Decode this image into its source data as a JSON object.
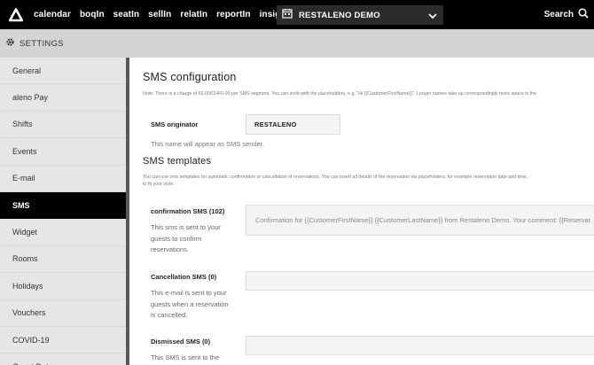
{
  "nav": {
    "items": [
      {
        "label": "calendar"
      },
      {
        "label": "boqIn"
      },
      {
        "label": "seatIn"
      },
      {
        "label": "sellIn"
      },
      {
        "label": "relatIn"
      },
      {
        "label": "reportIn"
      },
      {
        "label": "insights"
      }
    ],
    "venue": "RESTALENO DEMO",
    "search_label": "Search"
  },
  "settings": {
    "title": "SETTINGS"
  },
  "sidebar": {
    "items": [
      {
        "label": "General"
      },
      {
        "label": "aleno Pay"
      },
      {
        "label": "Shifts"
      },
      {
        "label": "Events"
      },
      {
        "label": "E-mail"
      },
      {
        "label": "SMS"
      },
      {
        "label": "Widget"
      },
      {
        "label": "Rooms"
      },
      {
        "label": "Holidays"
      },
      {
        "label": "Vouchers"
      },
      {
        "label": "COVID-19"
      },
      {
        "label": "Guest Data"
      }
    ],
    "active": "SMS"
  },
  "main": {
    "config_title": "SMS configuration",
    "config_note": "Note: There is a charge of €0.09/CHF0.09 per SMS segment. You can work with the placeholders, e.g. \"Hi {{CustomerFirstName}}\". Longer names take up correspondingly more space in the",
    "originator_label": "SMS originator",
    "originator_value": "RESTALENO",
    "originator_help": "This name will appear as SMS sender.",
    "templates_title": "SMS templates",
    "templates_note_1": "You can use sms templates for automatic confirmation or cancellation of reservations. You can insert all details of the reservation via placeholders, for example reservation date and time,",
    "templates_note_2": "to fit your style.",
    "templates": [
      {
        "label": "confirmation SMS (102)",
        "help": "This sms is sent to your guests to confirm reservations.",
        "value": "Confirmation for {{CustomerFirstName}} {{CustomerLastName}} from Restaleno Demo. Your comment: {{Reservat"
      },
      {
        "label": "Cancellation SMS (0)",
        "help": "This e-mail is sent to your guests when a reservation is cancelled.",
        "value": ""
      },
      {
        "label": "Dismissed SMS (0)",
        "help": "This SMS is sent to the",
        "value": ""
      }
    ]
  },
  "colors": {
    "topbar": "#000000",
    "settingsbar": "#d4d4d4",
    "sidebar": "#e6e6e6",
    "active": "#000000"
  }
}
